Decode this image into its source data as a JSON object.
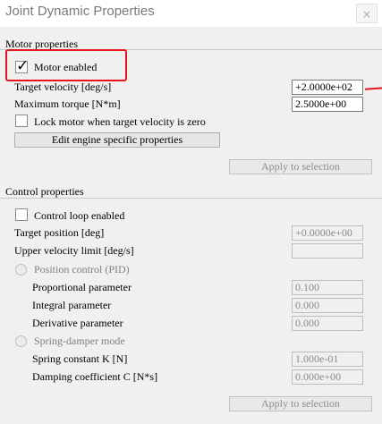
{
  "window": {
    "title": "Joint Dynamic Properties",
    "close_glyph": "×"
  },
  "motor": {
    "section_title": "Motor properties",
    "motor_enabled": {
      "label": "Motor enabled",
      "checked": true,
      "check_glyph": "✓"
    },
    "target_velocity": {
      "label": "Target velocity [deg/s]",
      "value": "+2.0000e+02"
    },
    "maximum_torque": {
      "label": "Maximum torque [N*m]",
      "value": "2.5000e+00"
    },
    "lock_motor": {
      "label": "Lock motor when target velocity is zero",
      "checked": false
    },
    "edit_engine_button": "Edit engine specific properties",
    "apply_button": "Apply to selection"
  },
  "control": {
    "section_title": "Control properties",
    "control_loop": {
      "label": "Control loop enabled",
      "checked": false
    },
    "target_position": {
      "label": "Target position [deg]",
      "value": "+0.0000e+00"
    },
    "upper_velocity_limit": {
      "label": "Upper velocity limit [deg/s]",
      "value": ""
    },
    "position_control": {
      "label": "Position control (PID)"
    },
    "proportional": {
      "label": "Proportional parameter",
      "value": "0.100"
    },
    "integral": {
      "label": "Integral parameter",
      "value": "0.000"
    },
    "derivative": {
      "label": "Derivative parameter",
      "value": "0.000"
    },
    "spring_damper": {
      "label": "Spring-damper mode"
    },
    "spring_constant": {
      "label": "Spring constant K [N]",
      "value": "1.000e-01"
    },
    "damping_coefficient": {
      "label": "Damping coefficient C [N*s]",
      "value": "0.000e+00"
    },
    "apply_button": "Apply to selection"
  },
  "annotation_color": "#e8141c",
  "icons": [
    "close-icon",
    "checkmark-icon",
    "radio-icon"
  ]
}
